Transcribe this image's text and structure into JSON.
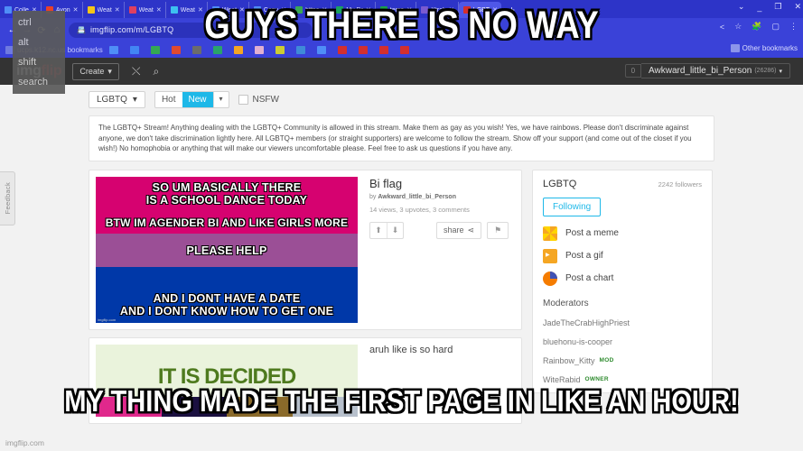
{
  "meme_caption": {
    "top": "GUYS THERE IS NO WAY",
    "bottom": "MY THING MADE THE FIRST PAGE IN LIKE AN HOUR!"
  },
  "browser": {
    "tabs": [
      {
        "label": "Colle",
        "color": "#4f8ef7",
        "active": false
      },
      {
        "label": "Avon",
        "color": "#e8412a",
        "active": false
      },
      {
        "label": "Weat",
        "color": "#f5c518",
        "active": false
      },
      {
        "label": "Weat",
        "color": "#e04060",
        "active": false
      },
      {
        "label": "Weat",
        "color": "#3dc0f0",
        "active": false
      },
      {
        "label": "Weat",
        "color": "#4f8ef7",
        "active": false
      },
      {
        "label": "Copy",
        "color": "#4f8ef7",
        "active": false
      },
      {
        "label": "https",
        "color": "#3aa757",
        "active": false
      },
      {
        "label": "My Dr",
        "color": "#1aa260",
        "active": false
      },
      {
        "label": "temp",
        "color": "#1a9e4b",
        "active": false
      },
      {
        "label": "Xtrah",
        "color": "#7a5ad0",
        "active": false
      },
      {
        "label": "LGBT",
        "color": "#d32f2f",
        "active": true
      }
    ],
    "new_tab_label": "+",
    "window_controls": [
      "⌄",
      "_",
      "❐",
      "✕"
    ],
    "nav": {
      "back": "←",
      "forward": "→",
      "reload": "⟳",
      "home": "⌂"
    },
    "url": "imgflip.com/m/LGBTQ",
    "url_icon": "📇",
    "toolbar_icons": [
      "<",
      "☆",
      "🧩",
      "▢",
      "⋮"
    ],
    "bookmarks_folder": "ucps.k12.nc.us bookmarks",
    "bookmark_icons": [
      "#4f8ef7",
      "#4285f4",
      "#34a853",
      "#e04a2f",
      "#6c6c6c",
      "#2aa36b",
      "#f5a623",
      "#e0b0d0",
      "#cccc33",
      "#3f8ad8",
      "#4f8ef7",
      "#d32f2f",
      "#d32f2f",
      "#d32f2f",
      "#d32f2f"
    ],
    "other_bookmarks": "Other bookmarks"
  },
  "keyboard_overlay": [
    "ctrl",
    "alt",
    "shift",
    "search"
  ],
  "feedback_tab": "Feedback",
  "imgflip": {
    "logo_img": "img",
    "logo_flip": "flip",
    "create_label": "Create",
    "create_caret": "▾",
    "shuffle_icon": "⤬",
    "search_icon": "⌕",
    "notification_count": "0",
    "username": "Awkward_little_bi_Person",
    "user_points": "(26286)",
    "user_caret": "▾"
  },
  "filters": {
    "stream_label": "LGBTQ",
    "stream_caret": "▾",
    "hot_label": "Hot",
    "new_label": "New",
    "sort_caret": "▾",
    "nsfw_label": "NSFW"
  },
  "stream_description": "The LGBTQ+ Stream! Anything dealing with the LGBTQ+ Community is allowed in this stream. Make them as gay as you wish! Yes, we have rainbows. Please don't discriminate against anyone, we don't take discrimination lightly here. All LGBTQ+ members (or straight supporters) are welcome to follow the stream. Show off your support (and come out of the closet if you wish!) No homophobia or anything that will make our viewers uncomfortable please. Feel free to ask us questions if you have any.",
  "post1": {
    "meme_lines": {
      "l1": "SO UM BASICALLY THERE",
      "l2": "IS A SCHOOL DANCE TODAY",
      "l3": "BTW IM AGENDER BI AND LIKE GIRLS MORE",
      "l4": "PLEASE HELP",
      "l5": "AND I DONT HAVE A DATE",
      "l6": "AND I DONT KNOW HOW TO GET ONE"
    },
    "watermark": "imgflip.com",
    "title": "Bi flag",
    "by_prefix": "by",
    "author": "Awkward_little_bi_Person",
    "stats": "14 views, 3 upvotes, 3 comments",
    "upvote_icon": "⬆",
    "downvote_icon": "⬇",
    "share_label": "share",
    "share_icon": "⋖",
    "flag_icon": "⚑"
  },
  "post2": {
    "title": "aruh like is so hard",
    "overlay_text": "IT IS DECIDED"
  },
  "sidebar": {
    "stream_name": "LGBTQ",
    "followers": "2242 followers",
    "follow_button": "Following",
    "actions": [
      {
        "label": "Post a meme",
        "icon": "meme-icon"
      },
      {
        "label": "Post a gif",
        "icon": "gif-icon"
      },
      {
        "label": "Post a chart",
        "icon": "chart-icon"
      }
    ],
    "moderators_title": "Moderators",
    "moderators": [
      {
        "name": "JadeTheCrabHighPriest",
        "badge": ""
      },
      {
        "name": "bluehonu-is-cooper",
        "badge": ""
      },
      {
        "name": "Rainbow_Kitty",
        "badge": "MOD"
      },
      {
        "name": "WiteRabid",
        "badge": "OWNER"
      }
    ]
  },
  "colors": {
    "browser_blue": "#3a42d8",
    "imgflip_dark": "#333333",
    "accent_cyan": "#1eb8e8",
    "flag_pink": "#d60270",
    "flag_purple": "#9b4f96",
    "flag_blue": "#0038a8"
  }
}
